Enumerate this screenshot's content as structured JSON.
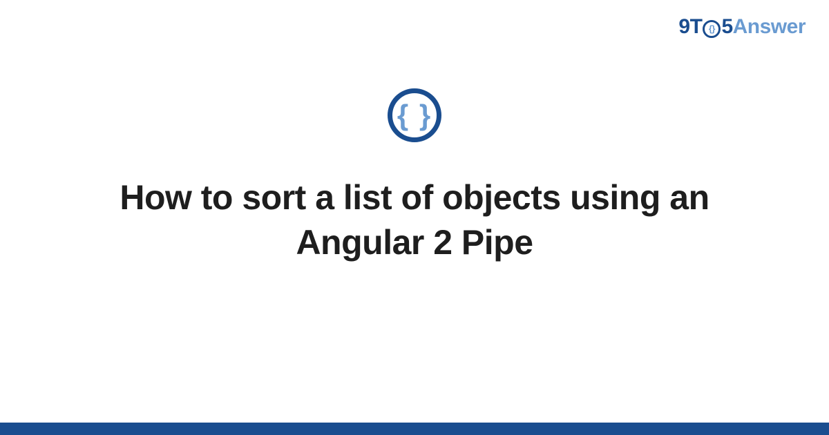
{
  "logo": {
    "part1": "9T",
    "circle": "{}",
    "part2": "5",
    "part3": "Answer"
  },
  "icon": {
    "braces": "{ }"
  },
  "title": "How to sort a list of objects using an Angular 2 Pipe"
}
